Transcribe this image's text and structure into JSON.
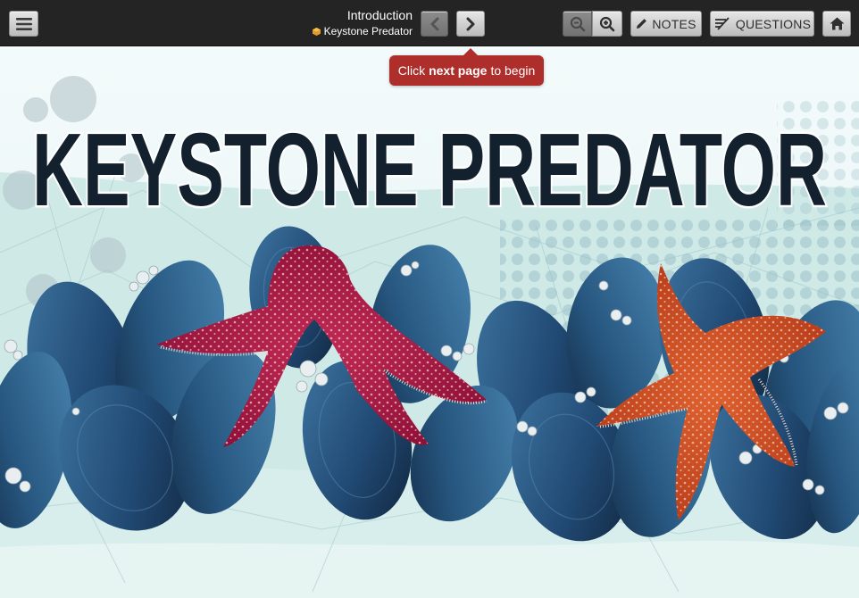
{
  "header": {
    "title": "Introduction",
    "subtitle": "Keystone Predator"
  },
  "toolbar": {
    "notes_label": "NOTES",
    "questions_label": "QUESTIONS"
  },
  "tooltip": {
    "prefix": "Click",
    "emphasis": "next page",
    "suffix": "to begin"
  },
  "hero": {
    "headline": "KEYSTONE PREDATOR"
  },
  "icons": {
    "menu": "hamburger-icon",
    "prev": "chevron-left-icon",
    "next": "chevron-right-icon",
    "zoom_out": "zoom-out-icon",
    "zoom_in": "zoom-in-icon",
    "notes": "pencil-icon",
    "questions": "question-lines-icon",
    "home": "home-icon",
    "subtitle_mark": "cube-icon"
  },
  "colors": {
    "topbar": "#242424",
    "tooltip": "#ad2e2b",
    "headline": "#13202e",
    "water": "#c9e8e6",
    "mussel_dark": "#14314e",
    "mussel_mid": "#2a5c86",
    "star_purple": "#a3163f",
    "star_orange": "#c9461f"
  }
}
